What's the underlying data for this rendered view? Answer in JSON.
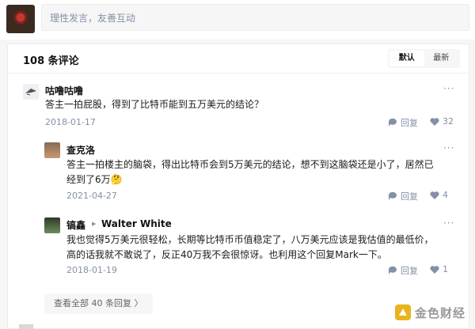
{
  "compose": {
    "placeholder": "理性发言，友善互动"
  },
  "comments_header": {
    "count_label": "108 条评论",
    "sort_options": [
      "默认",
      "最新"
    ],
    "active_sort": "默认"
  },
  "comments": [
    {
      "author": "咕噜咕噜",
      "content": "答主一拍屁股，得到了比特币能到五万美元的结论？",
      "date": "2018-01-17",
      "reply_label": "回复",
      "likes": "32",
      "more": "···"
    },
    {
      "author": "查克洛",
      "content_line1": "答主一拍楼主的脑袋，得出比特币会到5万美元的结论，想不到这脑袋还是小了，居然已",
      "content_line2": "经到了6万🤔",
      "date": "2021-04-27",
      "reply_label": "回复",
      "likes": "4",
      "more": "···"
    },
    {
      "author": "镐鑫",
      "reply_to": "Walter White",
      "content_line1": "我也觉得5万美元很轻松，长期等比特币币值稳定了，八万美元应该是我估值的最低价，",
      "content_line2": "高的话我就不敢说了，反正40万我不会很惊讶。也利用这个回复Mark一下。",
      "date": "2018-01-19",
      "reply_label": "回复",
      "likes": "1",
      "more": "···"
    }
  ],
  "view_all": "查看全部 40 条回复 〉",
  "watermark": "金色财经"
}
